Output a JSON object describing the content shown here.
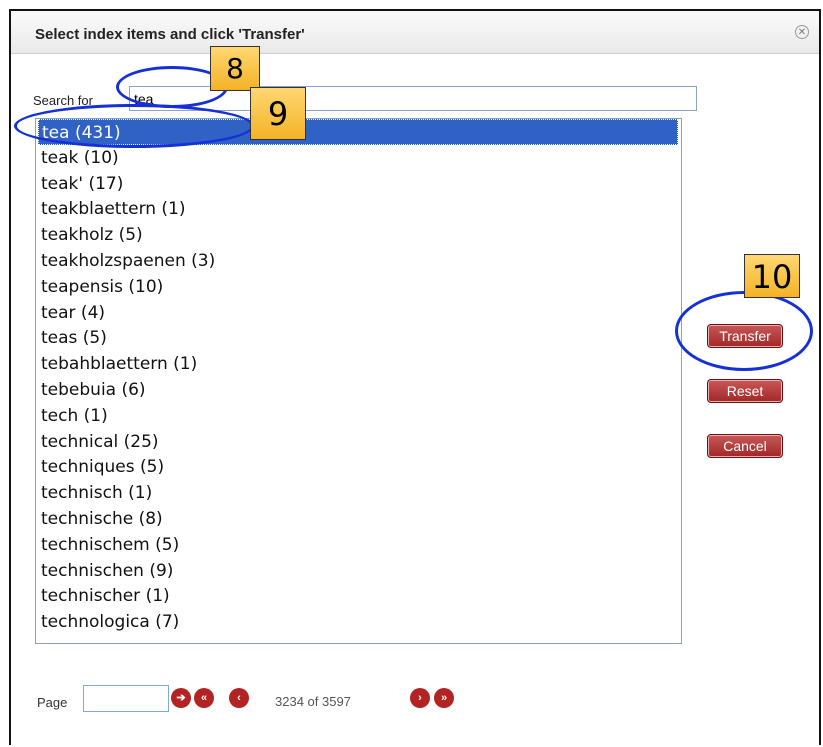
{
  "dialog": {
    "title": "Select index items and click 'Transfer'",
    "close_icon": "close-icon",
    "search_label": "Search for",
    "search_value": "tea"
  },
  "list": {
    "selected_index": 0,
    "items": [
      "tea (431)",
      "teak (10)",
      "teak' (17)",
      "teakblaettern (1)",
      "teakholz (5)",
      "teakholzspaenen (3)",
      "teapensis (10)",
      "tear (4)",
      "teas (5)",
      "tebahblaettern (1)",
      "tebebuia (6)",
      "tech (1)",
      "technical (25)",
      "techniques (5)",
      "technisch (1)",
      "technische (8)",
      "technischem (5)",
      "technischen (9)",
      "technischer (1)",
      "technologica (7)"
    ]
  },
  "buttons": {
    "transfer": "Transfer",
    "reset": "Reset",
    "cancel": "Cancel"
  },
  "pager": {
    "label": "Page",
    "input_value": "",
    "info": "3234 of 3597",
    "go_icon": "arrow-right-icon",
    "first_icon": "double-chevron-left-icon",
    "prev_icon": "chevron-left-icon",
    "next_icon": "chevron-right-icon",
    "last_icon": "double-chevron-right-icon"
  },
  "annotations": {
    "callout_8": "8",
    "callout_9": "9",
    "callout_10": "10",
    "callout_color": "#f6c342",
    "ellipse_color": "#1630d8"
  },
  "colors": {
    "selection": "#3062c6",
    "button": "#b32323"
  }
}
